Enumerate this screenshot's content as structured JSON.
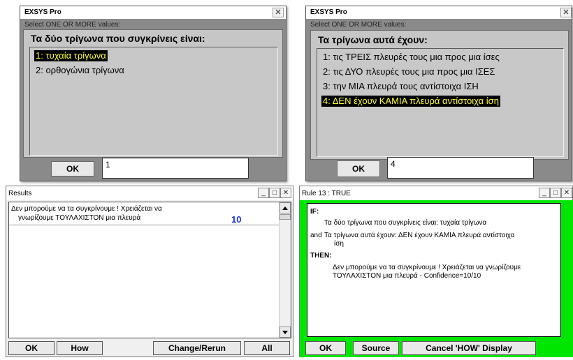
{
  "dialog1": {
    "app_title": "EXSYS Pro",
    "subtitle": "Select ONE OR MORE values:",
    "question": "Τα δύο τρίγωνα που συγκρίνεις είναι:",
    "options": [
      "1:  τυχαία τρίγωνα",
      "2:  ορθογώνια τρίγωνα"
    ],
    "selected_index": 0,
    "ok_label": "OK",
    "input_value": "1",
    "close_glyph": "✕"
  },
  "dialog2": {
    "app_title": "EXSYS Pro",
    "subtitle": "Select ONE OR MORE values:",
    "question": "Τα τρίγωνα αυτά έχουν:",
    "options": [
      "1:  τις ΤΡΕΙΣ πλευρές τους μια προς μια ίσες",
      "2:  τις ΔΥΟ πλευρές τους μια προς μια ΙΣΕΣ",
      "3:  την ΜΙΑ πλευρά τους αντίστοιχα ΙΣΗ",
      "4:  ΔΕΝ έχουν ΚΑΜΙΑ πλευρά αντίστοιχα ίση"
    ],
    "selected_index": 3,
    "ok_label": "OK",
    "input_value": "4",
    "close_glyph": "✕"
  },
  "results": {
    "title": "Results",
    "line1": "Δεν μπορούμε να τα συγκρίνουμε ! Χρειάζεται να",
    "line2": "γνωρίζουμε ΤΟΥΛΑΧΙΣΤΟΝ μια πλευρά",
    "value": "10",
    "buttons": {
      "ok": "OK",
      "how": "How",
      "change": "Change/Rerun",
      "all": "All"
    }
  },
  "rule": {
    "title": "Rule 13 : TRUE",
    "if_label": "IF:",
    "cond1": "Τα δύο τρίγωνα που συγκρίνεις είναι: τυχαία τρίγωνα",
    "and_label": "and",
    "cond2_line1": "Τα τρίγωνα αυτά έχουν: ΔΕΝ έχουν ΚΑΜΙΑ πλευρά αντίστοιχα",
    "cond2_line2": "ίση",
    "then_label": "THEN:",
    "result_line1": "Δεν μπορούμε να τα συγκρίνουμε ! Χρειάζεται να γνωρίζουμε",
    "result_line2": "ΤΟΥΛΑΧΙΣΤΟΝ μια πλευρά - Confidence=10/10",
    "buttons": {
      "ok": "OK",
      "source": "Source",
      "cancel": "Cancel 'HOW' Display"
    }
  },
  "window_controls": {
    "minimize": "_",
    "maximize": "□",
    "close": "✕"
  },
  "colors": {
    "highlight_bg": "#000000",
    "highlight_fg": "#ffff33",
    "value_blue": "#1a2ee6",
    "rule_green": "#00e600"
  }
}
